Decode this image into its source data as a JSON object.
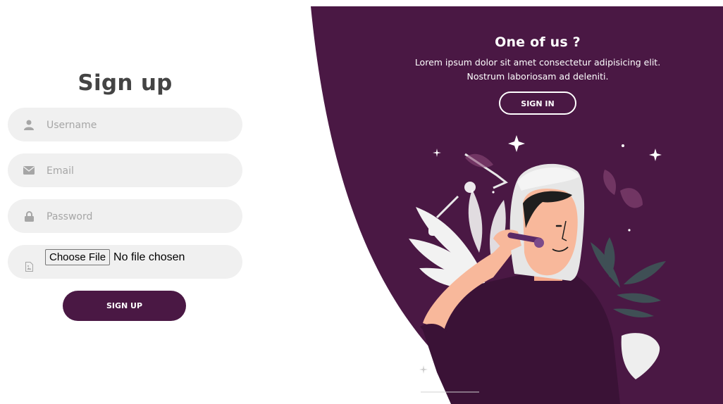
{
  "signup": {
    "title": "Sign up",
    "username_placeholder": "Username",
    "email_placeholder": "Email",
    "password_placeholder": "Password",
    "file_button": "Choose File",
    "file_status": "No file chosen",
    "submit_label": "SIGN UP"
  },
  "panel": {
    "title": "One of us ?",
    "text_line1": "Lorem ipsum dolor sit amet consectetur adipisicing elit.",
    "text_line2": "Nostrum laboriosam ad deleniti.",
    "signin_label": "SIGN IN"
  },
  "icons": {
    "username": "user-icon",
    "email": "envelope-icon",
    "password": "lock-icon",
    "file": "file-image-icon"
  },
  "colors": {
    "panel_bg": "#4a1844",
    "button_bg": "#4a1844",
    "field_bg": "#f0f0f0",
    "placeholder": "#a6a6a6",
    "title": "#444444"
  }
}
